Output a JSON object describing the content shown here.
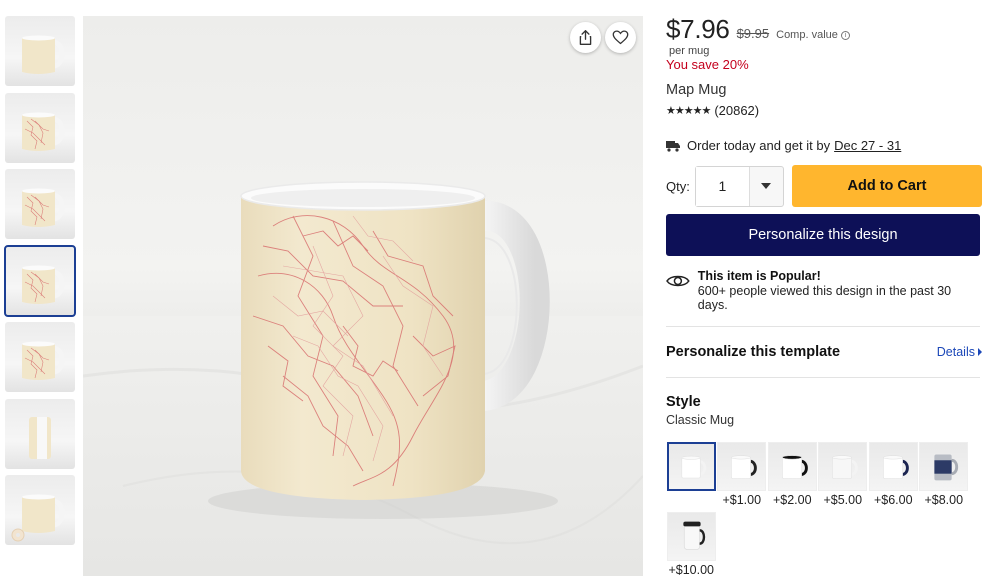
{
  "product": {
    "price": "$7.96",
    "original_price": "$9.95",
    "comp_value_label": "Comp. value",
    "per_unit": "per mug",
    "savings": "You save 20%",
    "name": "Map Mug",
    "stars": "★★★★★",
    "rating": 5,
    "review_count": "(20862)"
  },
  "delivery": {
    "text": "Order today and get it by",
    "date": "Dec 27 - 31"
  },
  "quantity": {
    "label": "Qty:",
    "value": "1"
  },
  "buttons": {
    "add_to_cart": "Add to Cart",
    "personalize": "Personalize this design"
  },
  "popular": {
    "title": "This item is Popular!",
    "text": "600+ people viewed this design in the past 30 days."
  },
  "template": {
    "title": "Personalize this template",
    "details_link": "Details"
  },
  "style": {
    "title": "Style",
    "selected": "Classic Mug",
    "options": [
      {
        "price": "",
        "mug": "classic",
        "selected": true
      },
      {
        "price": "+$1.00",
        "mug": "black-handle"
      },
      {
        "price": "+$2.00",
        "mug": "black-inside"
      },
      {
        "price": "+$5.00",
        "mug": "white-large"
      },
      {
        "price": "+$6.00",
        "mug": "navy-handle"
      },
      {
        "price": "+$8.00",
        "mug": "stein"
      },
      {
        "price": "+$10.00",
        "mug": "travel"
      }
    ]
  },
  "thumbnails": [
    {
      "variant": "plain",
      "selected": false
    },
    {
      "variant": "map",
      "selected": false
    },
    {
      "variant": "map",
      "selected": false
    },
    {
      "variant": "map",
      "selected": true
    },
    {
      "variant": "map-left",
      "selected": false
    },
    {
      "variant": "side",
      "selected": false
    },
    {
      "variant": "plain-donut",
      "selected": false
    }
  ],
  "colors": {
    "accent_yellow": "#ffb62e",
    "navy": "#0d1057",
    "sale_red": "#c4001d",
    "link_blue": "#1c48b8",
    "mug_cream": "#f1e6c9",
    "map_red": "#d8706f"
  }
}
